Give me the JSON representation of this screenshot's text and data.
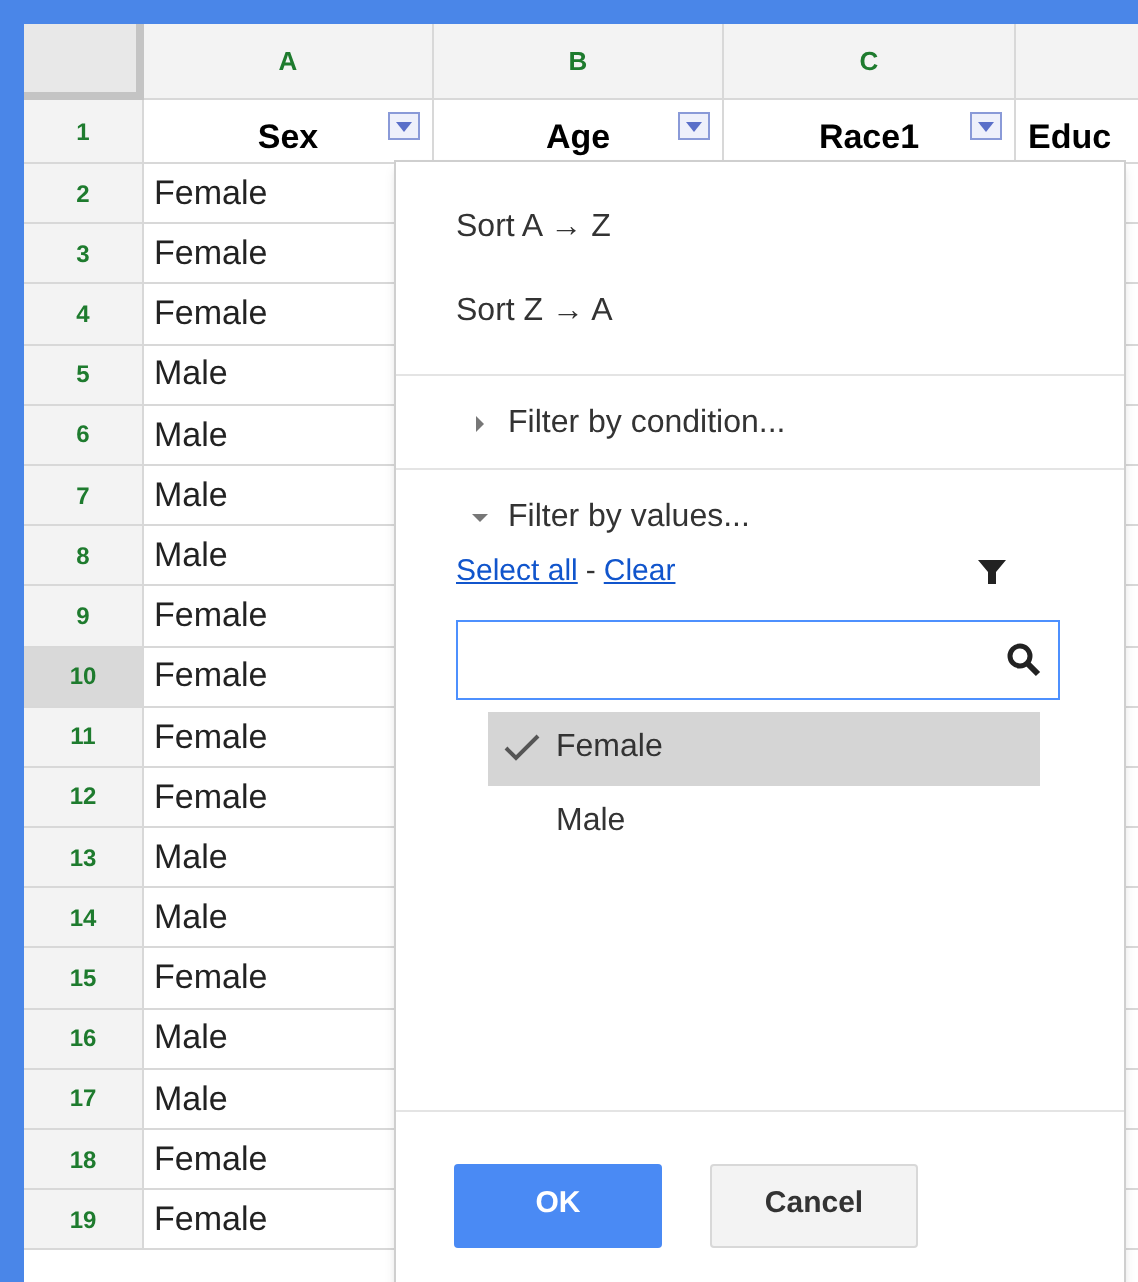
{
  "columns": [
    {
      "label": "A"
    },
    {
      "label": "B"
    },
    {
      "label": "C"
    }
  ],
  "header_row": {
    "number": "1",
    "cells": [
      {
        "text": "Sex",
        "filter": true
      },
      {
        "text": "Age",
        "filter": true
      },
      {
        "text": "Race1",
        "filter": true
      },
      {
        "text": "Educ"
      }
    ]
  },
  "rows": [
    {
      "number": "2",
      "value": "Female",
      "selected": false
    },
    {
      "number": "3",
      "value": "Female",
      "selected": false
    },
    {
      "number": "4",
      "value": "Female",
      "selected": false
    },
    {
      "number": "5",
      "value": "Male",
      "selected": false
    },
    {
      "number": "6",
      "value": "Male",
      "selected": false
    },
    {
      "number": "7",
      "value": "Male",
      "selected": false
    },
    {
      "number": "8",
      "value": "Male",
      "selected": false
    },
    {
      "number": "9",
      "value": "Female",
      "selected": false
    },
    {
      "number": "10",
      "value": "Female",
      "selected": true
    },
    {
      "number": "11",
      "value": "Female",
      "selected": false
    },
    {
      "number": "12",
      "value": "Female",
      "selected": false
    },
    {
      "number": "13",
      "value": "Male",
      "selected": false
    },
    {
      "number": "14",
      "value": "Male",
      "selected": false
    },
    {
      "number": "15",
      "value": "Female",
      "selected": false
    },
    {
      "number": "16",
      "value": "Male",
      "selected": false
    },
    {
      "number": "17",
      "value": "Male",
      "selected": false
    },
    {
      "number": "18",
      "value": "Female",
      "selected": false
    },
    {
      "number": "19",
      "value": "Female",
      "selected": false
    }
  ],
  "filter_menu": {
    "sort_items": [
      "Sort A → Z",
      "Sort Z → A"
    ],
    "sections": [
      {
        "label": "Filter by condition...",
        "expanded": false
      },
      {
        "label": "Filter by values...",
        "expanded": true
      }
    ],
    "select_all": "Select all",
    "separator": "-",
    "clear": "Clear",
    "values": [
      {
        "label": "Female",
        "checked": true
      },
      {
        "label": "Male",
        "checked": false
      }
    ],
    "ok": "OK",
    "cancel": "Cancel"
  }
}
